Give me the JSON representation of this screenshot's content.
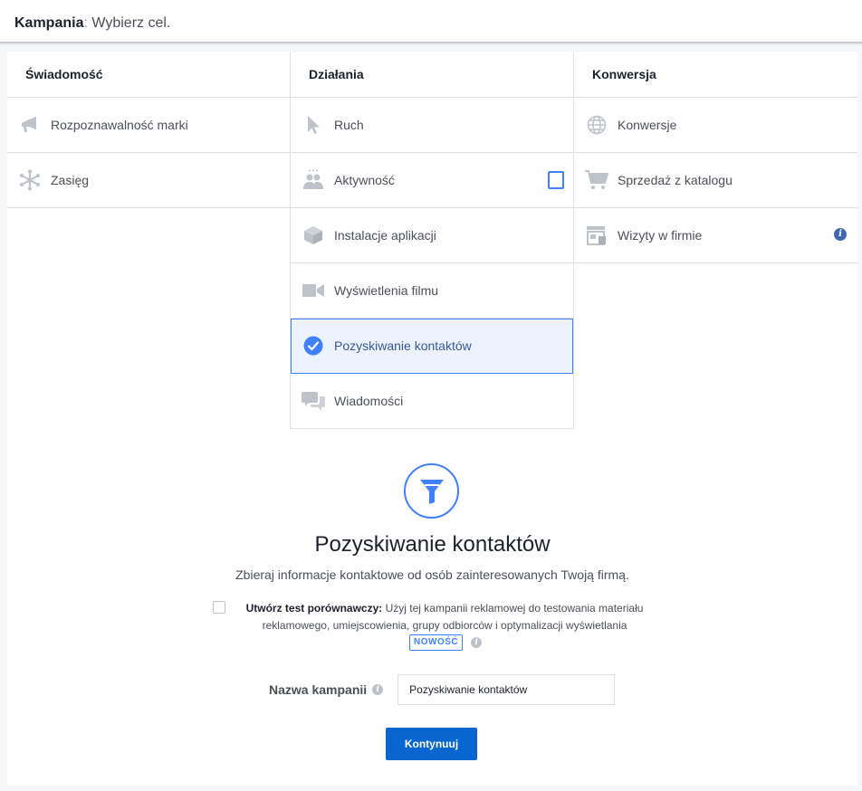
{
  "header": {
    "title_bold": "Kampania",
    "separator": ":",
    "subtitle": "Wybierz cel."
  },
  "columns": [
    {
      "title": "Świadomość",
      "items": [
        {
          "label": "Rozpoznawalność marki",
          "icon": "megaphone-icon"
        },
        {
          "label": "Zasięg",
          "icon": "reach-icon"
        }
      ]
    },
    {
      "title": "Działania",
      "items": [
        {
          "label": "Ruch",
          "icon": "cursor-icon"
        },
        {
          "label": "Aktywność",
          "icon": "people-icon"
        },
        {
          "label": "Instalacje aplikacji",
          "icon": "cube-icon"
        },
        {
          "label": "Wyświetlenia filmu",
          "icon": "video-camera-icon"
        },
        {
          "label": "Pozyskiwanie kontaktów",
          "icon": "check-circle-icon",
          "selected": true
        },
        {
          "label": "Wiadomości",
          "icon": "chat-bubbles-icon"
        }
      ]
    },
    {
      "title": "Konwersja",
      "items": [
        {
          "label": "Konwersje",
          "icon": "globe-icon"
        },
        {
          "label": "Sprzedaż z katalogu",
          "icon": "cart-icon"
        },
        {
          "label": "Wizyty w firmie",
          "icon": "store-icon"
        }
      ]
    }
  ],
  "detail": {
    "icon": "funnel-icon",
    "title": "Pozyskiwanie kontaktów",
    "description": "Zbieraj informacje kontaktowe od osób zainteresowanych Twoją firmą.",
    "ab_test_label": "Utwórz test porównawczy:",
    "ab_test_text_line1": " Użyj tej kampanii reklamowej do testowania materiału",
    "ab_test_text_line2": "reklamowego, umiejscowienia, grupy odbiorców i optymalizacji wyświetlania",
    "badge": "NOWOŚĆ",
    "campaign_name_label": "Nazwa kampanii",
    "campaign_name_value": "Pozyskiwanie kontaktów",
    "continue_label": "Kontynuuj"
  },
  "colors": {
    "accent": "#4080ff",
    "button": "#0866d1",
    "selected_bg": "#ecf3ff",
    "icon_gray": "#bec2c9"
  }
}
